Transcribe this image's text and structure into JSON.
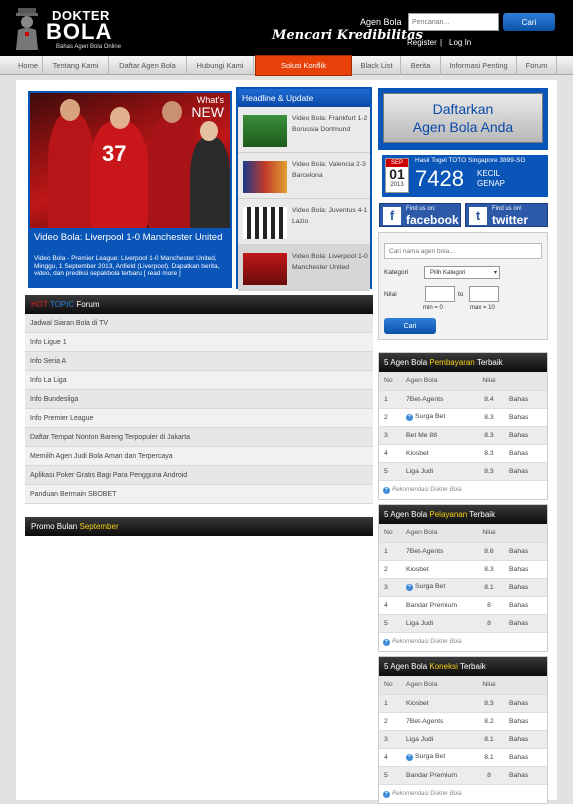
{
  "header": {
    "brand_line1": "DOKTER",
    "brand_line2": "BOLA",
    "brand_tagline": "Bahas Agen Bola Online",
    "agen_bola_label": "Agen Bola",
    "search_placeholder": "Pencarian...",
    "search_button": "Cari",
    "slogan": "Mencari Kredibilitas",
    "register": "Register",
    "separator": "|",
    "login": "Log In"
  },
  "nav": {
    "items": [
      "Home",
      "Tentang Kami",
      "Daftar Agen Bola",
      "Hubungi Kami",
      "Solusi Konflik",
      "Black List",
      "Berita",
      "Informasi Penting",
      "Forum"
    ],
    "active": "Solusi Konflik"
  },
  "featured": {
    "badge_line1": "What's",
    "badge_line2": "NEW",
    "title": "Video Bola: Liverpool 1-0 Manchester United",
    "description": "Video Bola - Premier League: Liverpool 1-0 Manchester United, Minggu, 1 September 2013, Anfield (Liverpool). Dapatkan berita, video, dan prediksi sepakbola terbaru [ read more ]",
    "jersey_numbers": [
      "37"
    ]
  },
  "headline": {
    "title": "Headline & Update",
    "items": [
      "Video Bola: Frankfurt 1-2 Borussia Dortmund",
      "Video Bola: Valencia 2-3 Barcelona",
      "Video Bola: Juventus 4-1 Lazio",
      "Video Bola: Liverpool 1-0 Manchester United"
    ]
  },
  "hot_topic": {
    "hot": "HOT",
    "topic": "TOPIC",
    "forum": "Forum",
    "items": [
      "Jadwal Siaran Bola di TV",
      "Info Ligue 1",
      "Info Seria A",
      "Info La Liga",
      "Info Bundesliga",
      "Info Premier League",
      "Daftar Tempat Nonton Bareng Terpopuler di Jakarta",
      "Memilih Agen Judi Bola Aman dan Terpercaya",
      "Aplikasi Poker Gratis Bagi Para Pengguna Android",
      "Panduan Bermain SBOBET"
    ]
  },
  "promo": {
    "prefix": "Promo Bulan",
    "month": "September"
  },
  "daftar": {
    "line1": "Daftarkan",
    "line2": "Agen Bola Anda"
  },
  "toto": {
    "month": "SEP",
    "day": "01",
    "year": "2013",
    "title": "Hasil Togel TOTO Singapore 3899-SG",
    "number": "7428",
    "result1": "KECIL",
    "result2": "GENAP"
  },
  "social": {
    "facebook_small": "Find us on:",
    "facebook": "facebook",
    "twitter_small": "Find us on!",
    "twitter": "twitter"
  },
  "search_box": {
    "placeholder": "Cari nama agen bola...",
    "kategori_label": "Kategori",
    "kategori_value": "Pilih Kategori",
    "nilai_label": "Nilai",
    "to": "to",
    "min": "min = 0",
    "max": "max = 10",
    "button": "Cari"
  },
  "rank_pembayaran": {
    "prefix": "5 Agen Bola",
    "highlight": "Pembayaran",
    "suffix": "Terbaik",
    "headers": [
      "No",
      "Agen Bola",
      "Nilai",
      ""
    ],
    "rows": [
      [
        "1",
        "7Bet-Agents",
        "8.4",
        "Bahas"
      ],
      [
        "2",
        "Surga Bet",
        "8.3",
        "Bahas"
      ],
      [
        "3",
        "Bet Me 88",
        "8.3",
        "Bahas"
      ],
      [
        "4",
        "Kiosbet",
        "8.3",
        "Bahas"
      ],
      [
        "5",
        "Liga Judi",
        "8.3",
        "Bahas"
      ]
    ],
    "plus_rows": [
      1
    ],
    "footer": "Rekomendasi Dokter Bola"
  },
  "rank_pelayanan": {
    "prefix": "5 Agen Bola",
    "highlight": "Pelayanan",
    "suffix": "Terbaik",
    "headers": [
      "No",
      "Agen Bola",
      "Nilai",
      ""
    ],
    "rows": [
      [
        "1",
        "7Bet-Agents",
        "8.6",
        "Bahas"
      ],
      [
        "2",
        "Kiosbet",
        "8.3",
        "Bahas"
      ],
      [
        "3",
        "Surga Bet",
        "8.1",
        "Bahas"
      ],
      [
        "4",
        "Bandar Premium",
        "8",
        "Bahas"
      ],
      [
        "5",
        "Liga Judi",
        "8",
        "Bahas"
      ]
    ],
    "plus_rows": [
      2
    ],
    "footer": "Rekomendasi Dokter Bola"
  },
  "rank_koneksi": {
    "prefix": "5 Agen Bola",
    "highlight": "Koneksi",
    "suffix": "Terbaik",
    "headers": [
      "No",
      "Agen Bola",
      "Nilai",
      ""
    ],
    "rows": [
      [
        "1",
        "Kiosbet",
        "8.3",
        "Bahas"
      ],
      [
        "2",
        "7Bet-Agents",
        "8.2",
        "Bahas"
      ],
      [
        "3",
        "Liga Judi",
        "8.1",
        "Bahas"
      ],
      [
        "4",
        "Surga Bet",
        "8.1",
        "Bahas"
      ],
      [
        "5",
        "Bandar Premium",
        "8",
        "Bahas"
      ]
    ],
    "plus_rows": [
      3
    ],
    "footer": "Rekomendasi Dokter Bola"
  }
}
